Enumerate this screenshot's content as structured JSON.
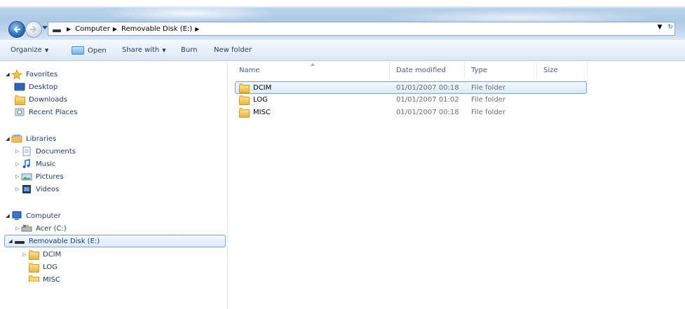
{
  "address_bar": {
    "crumbs": [
      "Computer",
      "Removable Disk (E:)"
    ]
  },
  "toolbar": {
    "organize": "Organize",
    "open": "Open",
    "share_with": "Share with",
    "burn": "Burn",
    "new_folder": "New folder"
  },
  "nav": {
    "favorites": {
      "label": "Favorites",
      "items": [
        "Desktop",
        "Downloads",
        "Recent Places"
      ]
    },
    "libraries": {
      "label": "Libraries",
      "items": [
        "Documents",
        "Music",
        "Pictures",
        "Videos"
      ]
    },
    "computer": {
      "label": "Computer",
      "drives": [
        "Acer (C:)",
        "Removable Disk (E:)"
      ],
      "subfolders": [
        "DCIM",
        "LOG",
        "MISC"
      ]
    }
  },
  "columns": {
    "name": "Name",
    "date_modified": "Date modified",
    "type": "Type",
    "size": "Size"
  },
  "files": [
    {
      "name": "DCIM",
      "date": "01/01/2007 00:18",
      "type": "File folder"
    },
    {
      "name": "LOG",
      "date": "01/01/2007 01:02",
      "type": "File folder"
    },
    {
      "name": "MISC",
      "date": "01/01/2007 00:18",
      "type": "File folder"
    }
  ],
  "icons": {
    "favorites": "star-icon",
    "desktop": "desktop-icon",
    "downloads": "downloads-icon",
    "recent_places": "recent-places-icon",
    "libraries": "libraries-icon",
    "documents": "document-icon",
    "music": "music-icon",
    "pictures": "pictures-icon",
    "videos": "video-icon",
    "computer": "computer-icon",
    "drive_c": "hard-drive-icon",
    "drive_e": "removable-disk-icon",
    "folder": "folder-icon"
  },
  "colors": {
    "selection_border": "#7da2ce",
    "selection_fill": "#dcebfc",
    "toolbar_text": "#1e395b"
  }
}
